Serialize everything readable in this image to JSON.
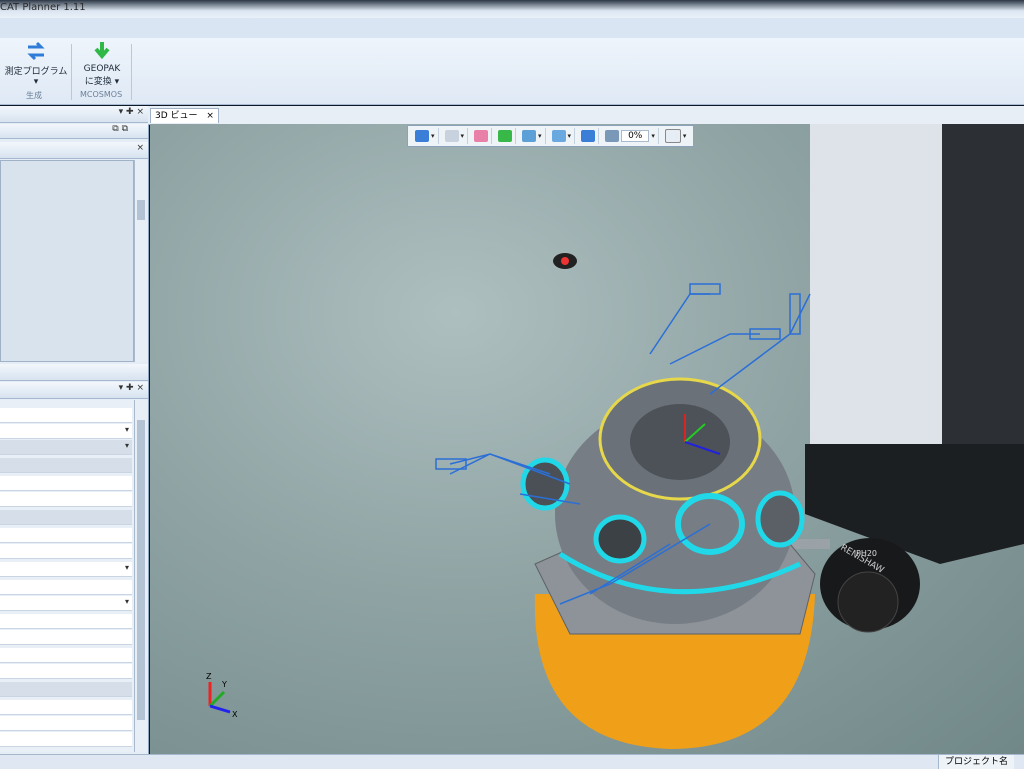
{
  "app": {
    "title": "CAT Planner 1.11"
  },
  "ribbon": {
    "buttons": [
      {
        "label": "測定プログラム",
        "arrow": "▾"
      },
      {
        "label": "GEOPAK",
        "label2": "に変換 ▾"
      }
    ],
    "groups": [
      "生成",
      "MCOSMOS"
    ]
  },
  "viewport": {
    "tab_label": "3D ビュー",
    "close": "×",
    "zoom": "0%",
    "axis": {
      "x": "X",
      "y": "Y",
      "z": "Z"
    },
    "probe_text": [
      "RENISHAW",
      "PH20"
    ]
  },
  "left_dock": {
    "panel1_controls": "▾ ✚ ×",
    "panel2_controls": "▾ ✚ ×"
  },
  "status": {
    "project_label": "プロジェクト名"
  },
  "colors": {
    "accent_blue": "#2b6fd6",
    "part_gray": "#747b82",
    "fixture_orange": "#f0a018",
    "highlight_cyan": "#20d8e8"
  }
}
